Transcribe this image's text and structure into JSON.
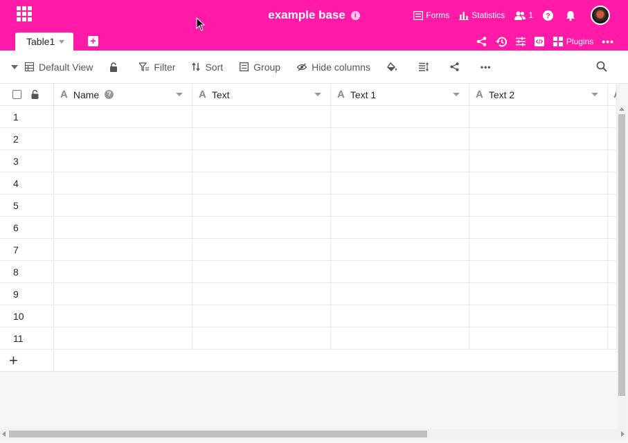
{
  "colors": {
    "brand": "#ff1aa7"
  },
  "header": {
    "apps_icon": "apps-grid-icon",
    "title": "example base",
    "info_icon": "info-icon",
    "forms_label": "Forms",
    "statistics_label": "Statistics",
    "collaborators_count": "1",
    "help_icon": "help-icon",
    "notifications_icon": "bell-icon",
    "plugins_label": "Plugins"
  },
  "tabs": [
    {
      "label": "Table1"
    }
  ],
  "toolbar": {
    "view_name": "Default View",
    "filter_label": "Filter",
    "sort_label": "Sort",
    "group_label": "Group",
    "hide_columns_label": "Hide columns"
  },
  "table": {
    "columns": [
      {
        "name": "Name",
        "type_icon": "text-type-icon"
      },
      {
        "name": "Text",
        "type_icon": "text-type-icon"
      },
      {
        "name": "Text 1",
        "type_icon": "text-type-icon"
      },
      {
        "name": "Text 2",
        "type_icon": "text-type-icon"
      }
    ],
    "rows": [
      "1",
      "2",
      "3",
      "4",
      "5",
      "6",
      "7",
      "8",
      "9",
      "10",
      "11"
    ],
    "add_row_icon": "plus-icon"
  }
}
